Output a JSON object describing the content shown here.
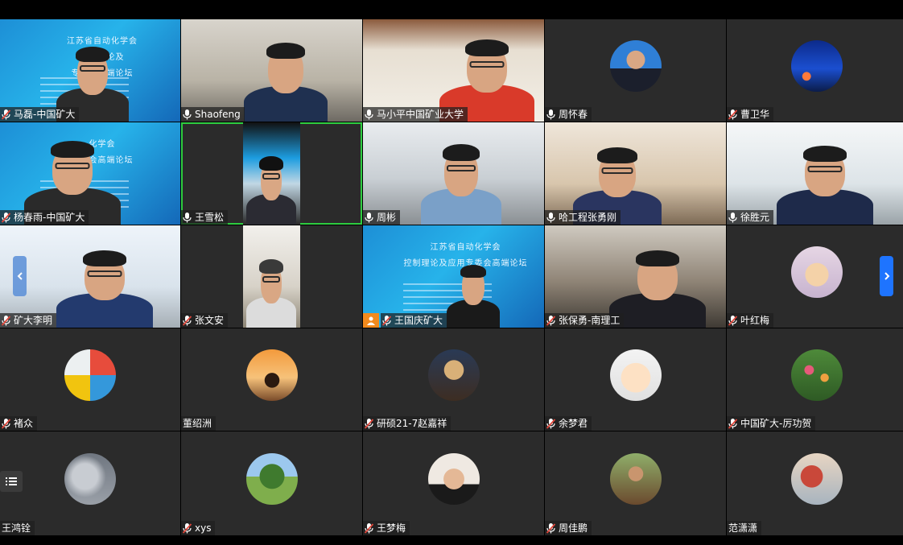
{
  "participants": [
    {
      "name": "马磊-中国矿大",
      "type": "video",
      "scene": "blue-slide",
      "mic": "muted",
      "slide": {
        "line1": "江苏省自动化学会",
        "line2": "控制理论及",
        "line3": "专委会高端论坛"
      }
    },
    {
      "name": "Shaofeng",
      "type": "video",
      "scene": "office",
      "mic": "active"
    },
    {
      "name": "马小平中国矿业大学",
      "type": "video",
      "scene": "home-red",
      "mic": "active"
    },
    {
      "name": "周怀春",
      "type": "avatar",
      "avatar": "suit-portrait",
      "mic": "active"
    },
    {
      "name": "曹卫华",
      "type": "avatar",
      "avatar": "night-sky",
      "mic": "muted"
    },
    {
      "name": "杨春雨-中国矿大",
      "type": "video",
      "scene": "blue-slide",
      "mic": "muted",
      "slide": {
        "line1": "化学会",
        "line2": "专委会高端论坛",
        "line3": ""
      }
    },
    {
      "name": "王雪松",
      "type": "video",
      "scene": "inset-narrow",
      "mic": "active",
      "speaking": true
    },
    {
      "name": "周彬",
      "type": "video",
      "scene": "room",
      "mic": "active"
    },
    {
      "name": "哈工程张勇刚",
      "type": "video",
      "scene": "bookshelf",
      "mic": "active"
    },
    {
      "name": "徐胜元",
      "type": "video",
      "scene": "bright-room",
      "mic": "active"
    },
    {
      "name": "矿大李明",
      "type": "video",
      "scene": "home",
      "mic": "muted"
    },
    {
      "name": "张文安",
      "type": "video",
      "scene": "inset-narrow",
      "mic": "muted"
    },
    {
      "name": "王国庆矿大",
      "type": "video",
      "scene": "blue-slide",
      "mic": "muted",
      "hand_raised": true,
      "slide": {
        "line1": "江苏省自动化学会",
        "line2": "控制理论及应用专委会高端论坛",
        "line3": ""
      }
    },
    {
      "name": "张保勇-南理工",
      "type": "video",
      "scene": "hall",
      "mic": "muted"
    },
    {
      "name": "叶红梅",
      "type": "avatar",
      "avatar": "plush-toy",
      "mic": "muted"
    },
    {
      "name": "褚众",
      "type": "avatar",
      "avatar": "rubiks-cube",
      "mic": "muted"
    },
    {
      "name": "董绍洲",
      "type": "avatar",
      "avatar": "sunset-silhouette",
      "mic": "none"
    },
    {
      "name": "研硕21-7赵嘉祥",
      "type": "avatar",
      "avatar": "hooded-figure",
      "mic": "muted"
    },
    {
      "name": "余梦君",
      "type": "avatar",
      "avatar": "cartoon-boy",
      "mic": "muted"
    },
    {
      "name": "中国矿大-厉功贺",
      "type": "avatar",
      "avatar": "flower-garden",
      "mic": "muted"
    },
    {
      "name": "王鸿铨",
      "type": "avatar",
      "avatar": "cloudy-sky",
      "mic": "none"
    },
    {
      "name": "xys",
      "type": "avatar",
      "avatar": "park-trees",
      "mic": "muted"
    },
    {
      "name": "王梦梅",
      "type": "avatar",
      "avatar": "child-portrait",
      "mic": "muted"
    },
    {
      "name": "周佳鹏",
      "type": "avatar",
      "avatar": "outdoor-portrait",
      "mic": "muted"
    },
    {
      "name": "范潇潇",
      "type": "avatar",
      "avatar": "anime-art",
      "mic": "none"
    }
  ],
  "controls": {
    "prev_page": "chevron-left-icon",
    "next_page": "chevron-right-icon",
    "participant_list": "list-icon"
  },
  "colors": {
    "tile_bg": "#2b2b2b",
    "speaking_border": "#2ecc40",
    "muted_mic": "#e0463a",
    "hand_badge": "#f28a1d",
    "nav_accent": "#1e74ff"
  }
}
